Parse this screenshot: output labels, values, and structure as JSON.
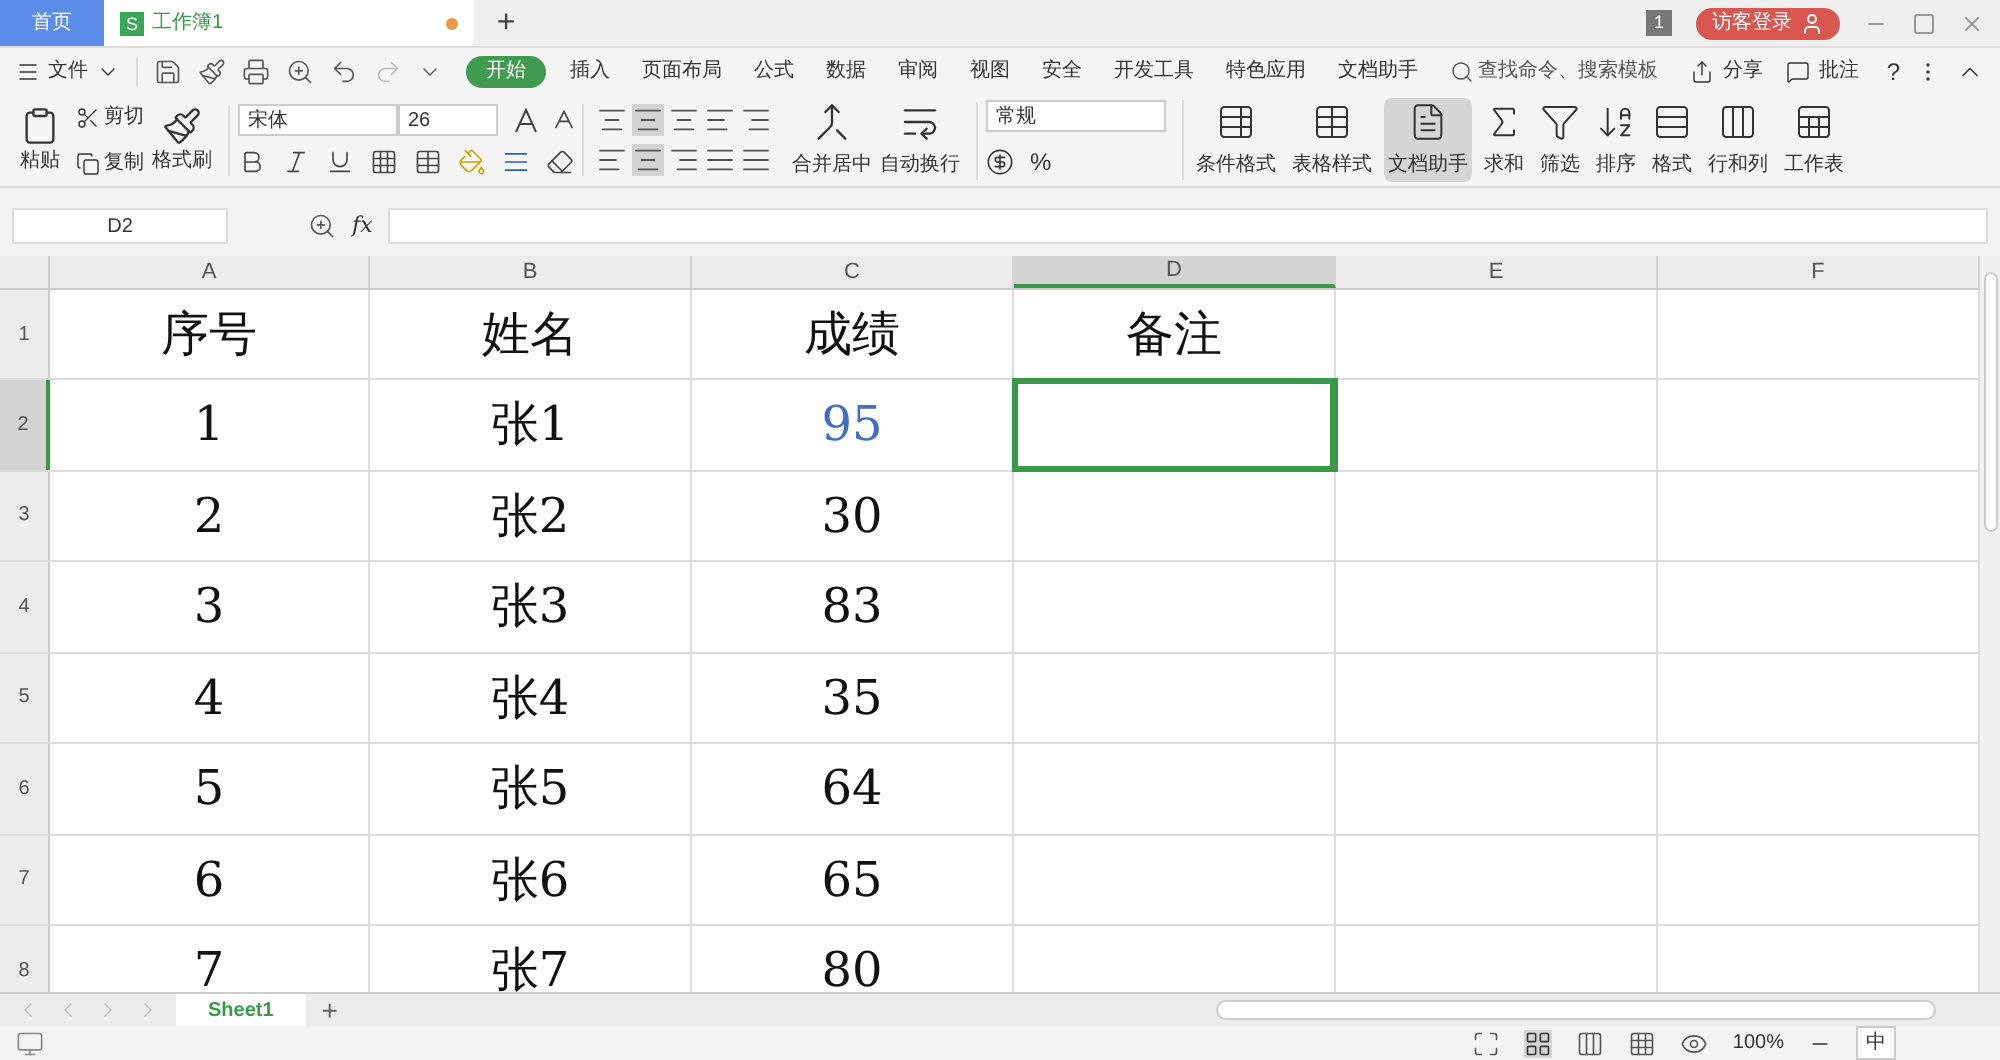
{
  "title_bar": {
    "home_tab": "首页",
    "doc_tab": {
      "label": "工作簿1",
      "icon_letter": "S",
      "unsaved": true
    },
    "new_tab": "+",
    "window_count": "1",
    "login": "访客登录"
  },
  "menu": {
    "file": "文件",
    "items": [
      {
        "label": "开始",
        "selected": true
      },
      {
        "label": "插入",
        "selected": false
      },
      {
        "label": "页面布局",
        "selected": false
      },
      {
        "label": "公式",
        "selected": false
      },
      {
        "label": "数据",
        "selected": false
      },
      {
        "label": "审阅",
        "selected": false
      },
      {
        "label": "视图",
        "selected": false
      },
      {
        "label": "安全",
        "selected": false
      },
      {
        "label": "开发工具",
        "selected": false
      },
      {
        "label": "特色应用",
        "selected": false
      },
      {
        "label": "文档助手",
        "selected": false
      }
    ],
    "search_placeholder": "查找命令、搜索模板",
    "share": "分享",
    "comment": "批注",
    "help": "?"
  },
  "toolbar": {
    "paste": "粘贴",
    "cut": "剪切",
    "copy": "复制",
    "format_painter": "格式刷",
    "font": "宋体",
    "font_size": "26",
    "merge": "合并居中",
    "wrap": "自动换行",
    "number_format": "常规",
    "percent": "%",
    "big_buttons": [
      {
        "kind": "cond",
        "label": "条件格式",
        "selected": false
      },
      {
        "kind": "style",
        "label": "表格样式",
        "selected": false
      },
      {
        "kind": "assistant",
        "label": "文档助手",
        "selected": true
      },
      {
        "kind": "sum",
        "label": "求和",
        "selected": false
      },
      {
        "kind": "filter",
        "label": "筛选",
        "selected": false
      },
      {
        "kind": "sort",
        "label": "排序",
        "selected": false
      },
      {
        "kind": "format",
        "label": "格式",
        "selected": false
      },
      {
        "kind": "rowcol",
        "label": "行和列",
        "selected": false
      },
      {
        "kind": "sheet",
        "label": "工作表",
        "selected": false
      }
    ]
  },
  "formula_bar": {
    "name_box": "D2",
    "fx": "fx"
  },
  "grid": {
    "columns": [
      {
        "label": "A",
        "selected": false
      },
      {
        "label": "B",
        "selected": false
      },
      {
        "label": "C",
        "selected": false
      },
      {
        "label": "D",
        "selected": true
      },
      {
        "label": "E",
        "selected": false
      },
      {
        "label": "F",
        "selected": false
      }
    ],
    "rows": [
      {
        "number": "1",
        "selected": false,
        "cells": [
          {
            "text": "序号",
            "color": "#111111"
          },
          {
            "text": "姓名",
            "color": "#111111"
          },
          {
            "text": "成绩",
            "color": "#111111"
          },
          {
            "text": "备注",
            "color": "#111111"
          }
        ]
      },
      {
        "number": "2",
        "selected": true,
        "cells": [
          {
            "text": "1",
            "color": "#111111"
          },
          {
            "text": "张1",
            "color": "#111111"
          },
          {
            "text": "95",
            "color": "#3f6fc0"
          }
        ]
      },
      {
        "number": "3",
        "selected": false,
        "cells": [
          {
            "text": "2",
            "color": "#111111"
          },
          {
            "text": "张2",
            "color": "#111111"
          },
          {
            "text": "30",
            "color": "#111111"
          }
        ]
      },
      {
        "number": "4",
        "selected": false,
        "cells": [
          {
            "text": "3",
            "color": "#111111"
          },
          {
            "text": "张3",
            "color": "#111111"
          },
          {
            "text": "83",
            "color": "#111111"
          }
        ]
      },
      {
        "number": "5",
        "selected": false,
        "cells": [
          {
            "text": "4",
            "color": "#111111"
          },
          {
            "text": "张4",
            "color": "#111111"
          },
          {
            "text": "35",
            "color": "#111111"
          }
        ]
      },
      {
        "number": "6",
        "selected": false,
        "cells": [
          {
            "text": "5",
            "color": "#111111"
          },
          {
            "text": "张5",
            "color": "#111111"
          },
          {
            "text": "64",
            "color": "#111111"
          }
        ]
      },
      {
        "number": "7",
        "selected": false,
        "cells": [
          {
            "text": "6",
            "color": "#111111"
          },
          {
            "text": "张6",
            "color": "#111111"
          },
          {
            "text": "65",
            "color": "#111111"
          }
        ]
      },
      {
        "number": "8",
        "selected": false,
        "cells": [
          {
            "text": "7",
            "color": "#111111"
          },
          {
            "text": "张7",
            "color": "#111111"
          },
          {
            "text": "80",
            "color": "#111111"
          }
        ]
      }
    ]
  },
  "sheet_tabs": [
    {
      "label": "Sheet1",
      "selected": true
    }
  ],
  "add_sheet": "+",
  "status_bar": {
    "zoom": "100%",
    "ime": "中"
  }
}
